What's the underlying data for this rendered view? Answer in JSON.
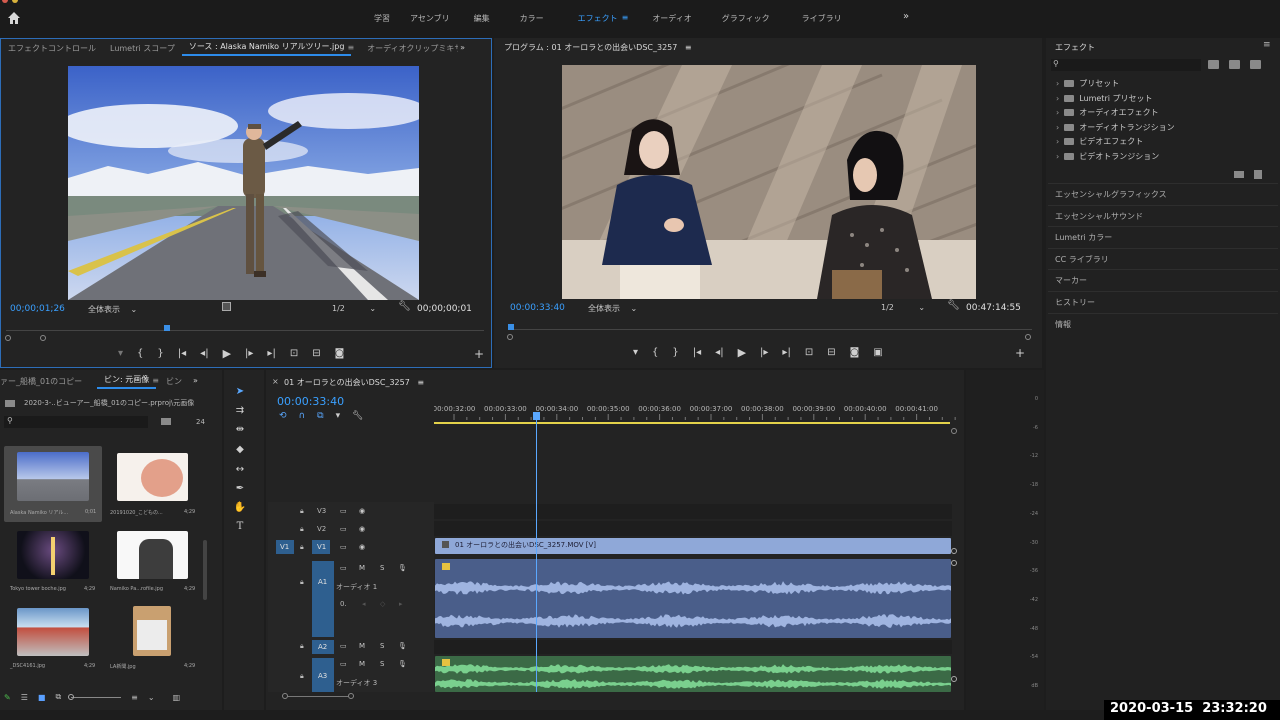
{
  "top_nav": {
    "workspaces": [
      "学習",
      "アセンブリ",
      "編集",
      "カラー",
      "エフェクト",
      "オーディオ",
      "グラフィック",
      "ライブラリ"
    ],
    "active": "エフェクト"
  },
  "source_panel": {
    "tabs": [
      "エフェクトコントロール",
      "Lumetri スコープ",
      "ソース : Alaska Namiko リアルツリー.jpg",
      "オーディオクリップミキサ"
    ],
    "active_tab": "ソース : Alaska Namiko リアルツリー.jpg",
    "timecode_current": "00;00;01;26",
    "zoom": "全体表示",
    "resolution": "1/2",
    "timecode_duration": "00;00;00;01"
  },
  "program_panel": {
    "title": "プログラム : 01 オーロラとの出会いDSC_3257",
    "timecode_current": "00:00:33:40",
    "zoom": "全体表示",
    "resolution": "1/2",
    "timecode_duration": "00:47:14:55"
  },
  "effects_panel": {
    "title": "エフェクト",
    "tree": [
      "プリセット",
      "Lumetri プリセット",
      "オーディオエフェクト",
      "オーディオトランジション",
      "ビデオエフェクト",
      "ビデオトランジション"
    ],
    "sections": [
      "エッセンシャルグラフィックス",
      "エッセンシャルサウンド",
      "Lumetri カラー",
      "CC ライブラリ",
      "マーカー",
      "ヒストリー",
      "情報"
    ]
  },
  "project_panel": {
    "tabs": [
      "ァー_船橋_01のコピー",
      "ビン: 元画像",
      "ビン"
    ],
    "active_tab": "ビン: 元画像",
    "path": "2020-3-..ビューアー_船橋_01のコピー.prproj\\元画像",
    "item_count": "24",
    "items": [
      {
        "name": "Alaska Namiko リアル...",
        "duration": "0;01"
      },
      {
        "name": "20191020_こどもの...",
        "duration": "4;29"
      },
      {
        "name": "Tokyo tower boche.jpg",
        "duration": "4;29"
      },
      {
        "name": "Namiko Pa...rofile.jpg",
        "duration": "4;29"
      },
      {
        "name": "_DSC4161.jpg",
        "duration": "4;29"
      },
      {
        "name": "LA新聞.jpg",
        "duration": "4;29"
      }
    ]
  },
  "timeline": {
    "title": "01 オーロラとの出会いDSC_3257",
    "timecode": "00:00:33:40",
    "ruler": [
      "00:00:32:00",
      "00:00:33:00",
      "00:00:34:00",
      "00:00:35:00",
      "00:00:36:00",
      "00:00:37:00",
      "00:00:38:00",
      "00:00:39:00",
      "00:00:40:00",
      "00:00:41:00"
    ],
    "video_tracks": [
      "V3",
      "V2",
      "V1"
    ],
    "audio_tracks": [
      "A1",
      "A2",
      "A3"
    ],
    "clip_v1": "01 オーロラとの出会いDSC_3257.MOV [V]",
    "a1_name": "オーディオ 1",
    "a1_volume": "0.",
    "a3_name": "オーディオ 3"
  },
  "meter": {
    "scale": [
      "0",
      "-6",
      "-12",
      "-18",
      "-24",
      "-30",
      "-36",
      "-42",
      "-48",
      "-54",
      "dB"
    ]
  },
  "datetime": "2020-03-15  23:32:20",
  "colors": {
    "accent": "#2d8ceb",
    "video_clip": "#8fa8d8",
    "audio_clip": "#6e86c0",
    "audio_green": "#4fae6a",
    "playhead": "#5aa8ff"
  }
}
